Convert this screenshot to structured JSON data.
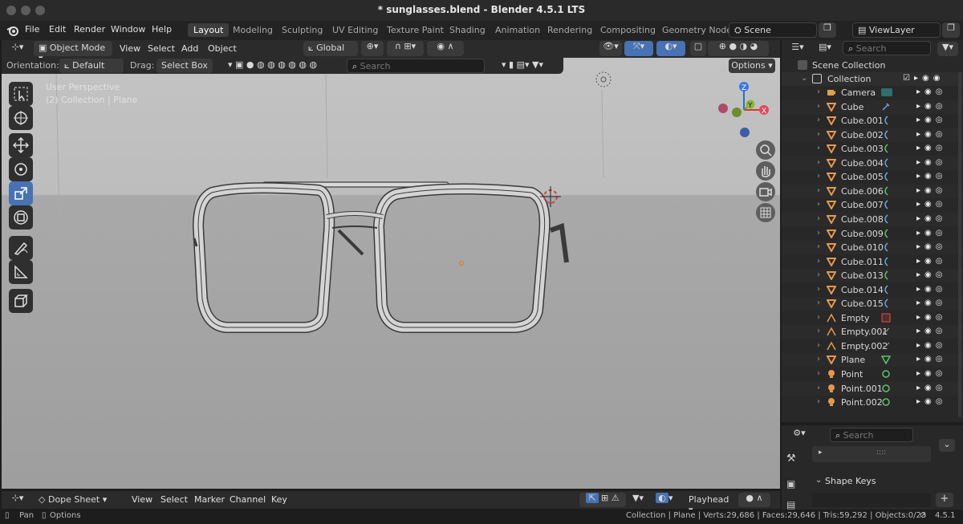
{
  "title": "* sunglasses.blend - Blender 4.5.1 LTS",
  "menu": [
    "File",
    "Edit",
    "Render",
    "Window",
    "Help"
  ],
  "workspaces": [
    "Layout",
    "Modeling",
    "Sculpting",
    "UV Editing",
    "Texture Paint",
    "Shading",
    "Animation",
    "Rendering",
    "Compositing",
    "Geometry Node"
  ],
  "active_workspace": "Layout",
  "scene": "Scene",
  "view_layer": "ViewLayer",
  "viewport": {
    "mode": "Object Mode",
    "menus": [
      "View",
      "Select",
      "Add",
      "Object"
    ],
    "transform_orientation": "Global",
    "orientation_label": "Orientation:",
    "orientation_value": "Default",
    "drag_label": "Drag:",
    "drag_value": "Select Box",
    "search_placeholder": "Search",
    "options_label": "Options",
    "view_name": "User Perspective",
    "view_info": "(2) Collection | Plane"
  },
  "outliner": {
    "search_placeholder": "Search",
    "scene_collection": "Scene Collection",
    "collection": "Collection",
    "items": [
      {
        "name": "Camera",
        "type": "camera",
        "modifier": "camera-data-icon"
      },
      {
        "name": "Cube",
        "type": "mesh",
        "modifier": "wrench-icon"
      },
      {
        "name": "Cube.001",
        "type": "mesh",
        "modifier": "curve-icon"
      },
      {
        "name": "Cube.002",
        "type": "mesh",
        "modifier": "curve-icon"
      },
      {
        "name": "Cube.003",
        "type": "mesh",
        "modifier": "curve-icon"
      },
      {
        "name": "Cube.004",
        "type": "mesh",
        "modifier": "curve-icon"
      },
      {
        "name": "Cube.005",
        "type": "mesh",
        "modifier": "curve-icon"
      },
      {
        "name": "Cube.006",
        "type": "mesh",
        "modifier": "curve-icon"
      },
      {
        "name": "Cube.007",
        "type": "mesh",
        "modifier": "curve-icon"
      },
      {
        "name": "Cube.008",
        "type": "mesh",
        "modifier": "curve-icon"
      },
      {
        "name": "Cube.009",
        "type": "mesh",
        "modifier": "curve-icon"
      },
      {
        "name": "Cube.010",
        "type": "mesh",
        "modifier": "curve-icon"
      },
      {
        "name": "Cube.011",
        "type": "mesh",
        "modifier": "curve-icon"
      },
      {
        "name": "Cube.013",
        "type": "mesh",
        "modifier": "curve-icon"
      },
      {
        "name": "Cube.014",
        "type": "mesh",
        "modifier": "curve-icon"
      },
      {
        "name": "Cube.015",
        "type": "mesh",
        "modifier": "curve-icon"
      },
      {
        "name": "Empty",
        "type": "empty",
        "modifier": "image-icon"
      },
      {
        "name": "Empty.001",
        "type": "empty",
        "modifier": "empty-icon"
      },
      {
        "name": "Empty.002",
        "type": "empty",
        "modifier": "empty-icon"
      },
      {
        "name": "Plane",
        "type": "mesh",
        "modifier": "mesh-data-icon"
      },
      {
        "name": "Point",
        "type": "light",
        "modifier": "light-data-icon"
      },
      {
        "name": "Point.001",
        "type": "light",
        "modifier": "light-data-icon"
      },
      {
        "name": "Point.002",
        "type": "light",
        "modifier": "light-data-icon"
      }
    ]
  },
  "properties": {
    "search_placeholder": "Search",
    "panel_title": "Shape Keys",
    "dots": "::::"
  },
  "dope_sheet": {
    "editor": "Dope Sheet",
    "menus": [
      "View",
      "Select",
      "Marker",
      "Channel",
      "Key"
    ],
    "playhead": "Playhead"
  },
  "status": {
    "pan": "Pan",
    "options": "Options",
    "stats": "Collection | Plane | Verts:29,686 | Faces:29,646 | Tris:59,292 | Objects:0/23",
    "version": "4.5.1"
  },
  "colors": {
    "accent": "#4772b3",
    "mesh_icon": "#e5994d",
    "modifier_blue": "#6aa6e0",
    "modifier_green": "#5ec26a"
  }
}
